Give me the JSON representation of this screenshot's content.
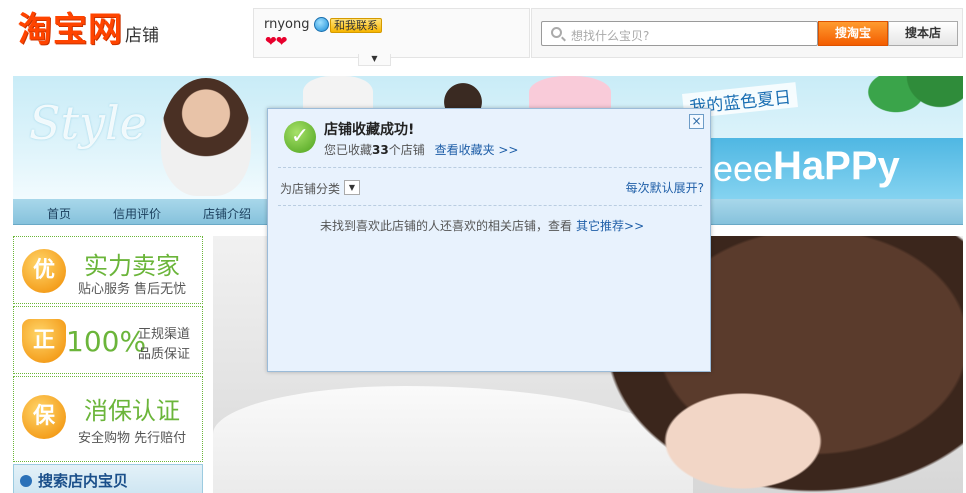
{
  "header": {
    "logo_text": "淘宝网",
    "logo_sub": "店铺",
    "seller_name": "rnyong",
    "contact_label": "和我联系",
    "hearts": "❤❤",
    "dropdown_glyph": "▼"
  },
  "search": {
    "placeholder": "想找什么宝贝?",
    "btn_taobao": "搜淘宝",
    "btn_shop": "搜本店"
  },
  "banner": {
    "style_text": "Style",
    "slogan": "我的蓝色夏日",
    "eee_text": "eee",
    "happy_text": "HaPPy"
  },
  "nav": {
    "items": [
      "首页",
      "信用评价",
      "店铺介绍"
    ]
  },
  "sidebar": {
    "promo1": {
      "badge": "优",
      "title": "实力卖家",
      "sub": "贴心服务 售后无忧"
    },
    "promo2": {
      "badge": "正",
      "big": "100%",
      "line1": "正规渠道",
      "line2": "品质保证"
    },
    "promo3": {
      "badge": "保",
      "title": "消保认证",
      "sub": "安全购物 先行赔付"
    },
    "search_title": "搜索店内宝贝"
  },
  "dialog": {
    "close_glyph": "×",
    "title": "店铺收藏成功!",
    "count_prefix": "您已收藏",
    "count": "33",
    "count_suffix": "个店铺",
    "view_link": "查看收藏夹 >>",
    "category_label": "为店铺分类",
    "category_glyph": "▼",
    "expand_link": "每次默认展开?",
    "message": "未找到喜欢此店铺的人还喜欢的相关店铺，查看",
    "other_link": "其它推荐>>"
  },
  "colors": {
    "brand_orange": "#ff4400",
    "link_blue": "#1f5fa8",
    "promo_green": "#6bb53a",
    "dialog_bg": "#e8f2fd"
  }
}
